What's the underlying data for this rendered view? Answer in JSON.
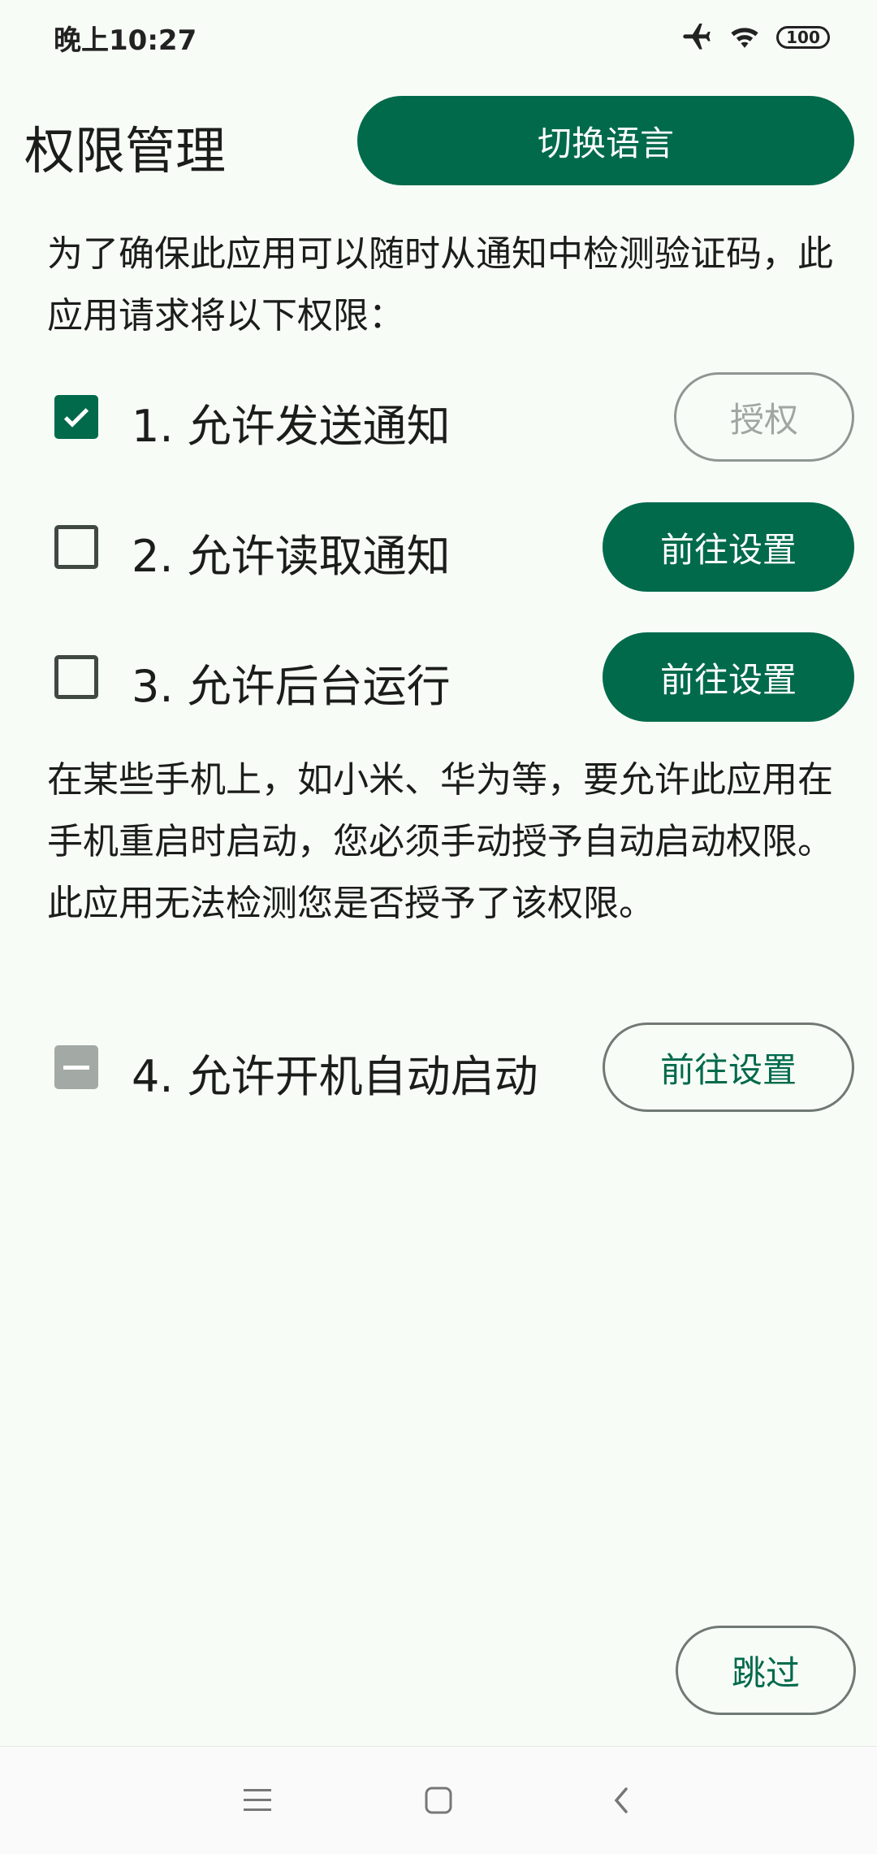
{
  "status_bar": {
    "time": "晚上10:27",
    "battery": "100",
    "icons": [
      "airplane-icon",
      "wifi-icon",
      "battery-icon"
    ]
  },
  "header": {
    "title": "权限管理",
    "switch_language_label": "切换语言"
  },
  "intro": "为了确保此应用可以随时从通知中检测验证码，此应用请求将以下权限：",
  "permissions": [
    {
      "label": "1. 允许发送通知",
      "state": "checked",
      "button": "授权",
      "button_style": "disabled"
    },
    {
      "label": "2. 允许读取通知",
      "state": "unchecked",
      "button": "前往设置",
      "button_style": "filled"
    },
    {
      "label": "3. 允许后台运行",
      "state": "unchecked",
      "button": "前往设置",
      "button_style": "filled"
    },
    {
      "label": "4. 允许开机自动启动",
      "state": "indeterminate",
      "button": "前往设置",
      "button_style": "outline"
    }
  ],
  "note": "在某些手机上，如小米、华为等，要允许此应用在手机重启时启动，您必须手动授予自动启动权限。此应用无法检测您是否授予了该权限。",
  "skip_label": "跳过",
  "nav_bar": [
    "menu-icon",
    "home-icon",
    "back-icon"
  ],
  "colors": {
    "accent": "#006a4b",
    "background": "#f8fcf7",
    "outline": "#707973"
  }
}
